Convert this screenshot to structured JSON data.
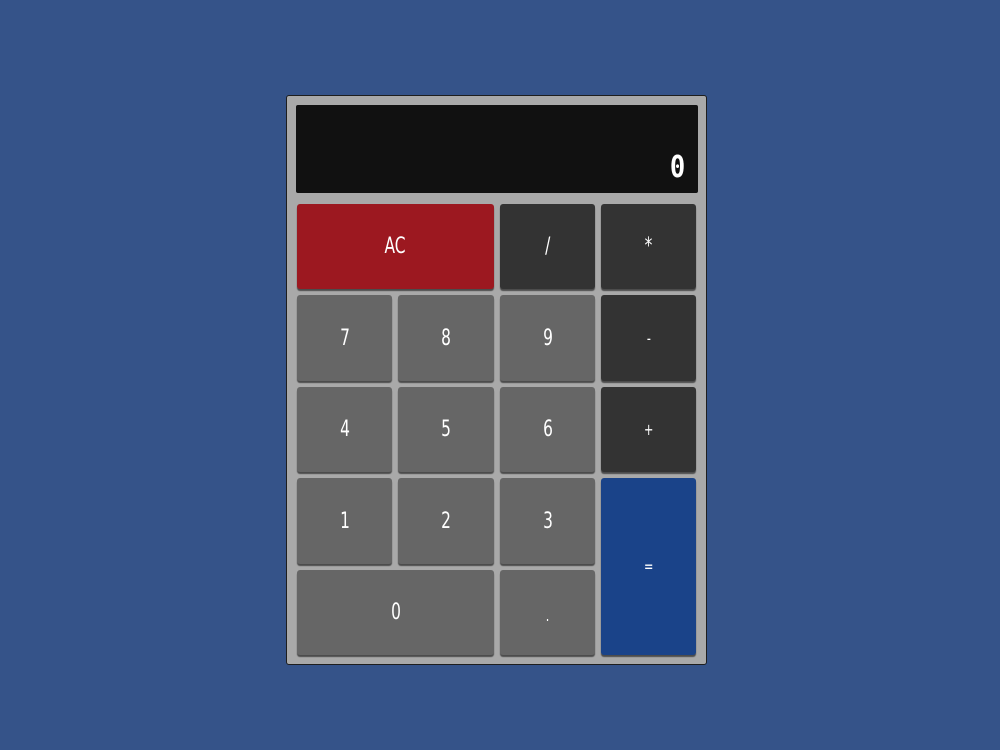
{
  "display": {
    "value": "0"
  },
  "keys": {
    "clear": "AC",
    "divide": "/",
    "multiply": "*",
    "subtract": "-",
    "add": "+",
    "equals": "=",
    "decimal": ".",
    "d0": "0",
    "d1": "1",
    "d2": "2",
    "d3": "3",
    "d4": "4",
    "d5": "5",
    "d6": "6",
    "d7": "7",
    "d8": "8",
    "d9": "9"
  },
  "colors": {
    "background": "#355389",
    "frame": "#a9a9a9",
    "display": "#111111",
    "number_key": "#666666",
    "operator_key": "#333333",
    "clear_key": "#9c1820",
    "equals_key": "#1a4389"
  }
}
